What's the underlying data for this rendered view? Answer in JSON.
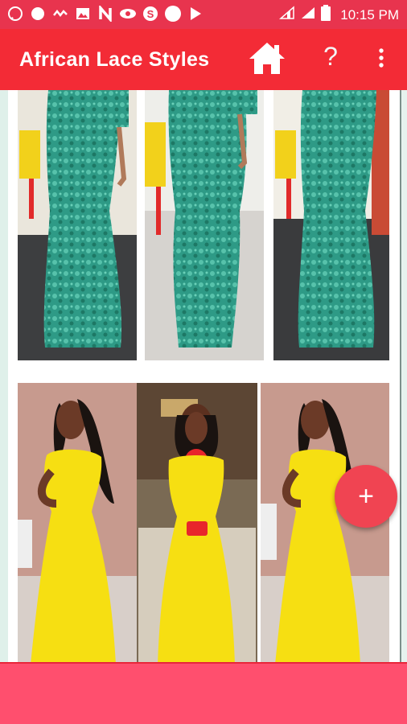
{
  "status_bar": {
    "time": "10:15 PM",
    "icons": [
      "whatsapp-icon",
      "compass-icon",
      "signal-wave-icon",
      "image-icon",
      "n-app-icon",
      "eye-icon",
      "s-app-icon",
      "circle-icon",
      "play-store-icon"
    ]
  },
  "toolbar": {
    "title": "African Lace Styles",
    "help_label": "?",
    "home_icon": "home-icon",
    "more_icon": "more-vert-icon"
  },
  "gallery": {
    "rows": [
      {
        "label": "green-lace-gown",
        "color": "#2e9a86"
      },
      {
        "label": "yellow-mermaid-dress",
        "color": "#f3dd12"
      }
    ]
  },
  "fab": {
    "label": "+"
  },
  "colors": {
    "status_bar": "#e8344e",
    "toolbar": "#f32b36",
    "fab": "#f04452",
    "bottom_bar": "#ff4f6e"
  }
}
